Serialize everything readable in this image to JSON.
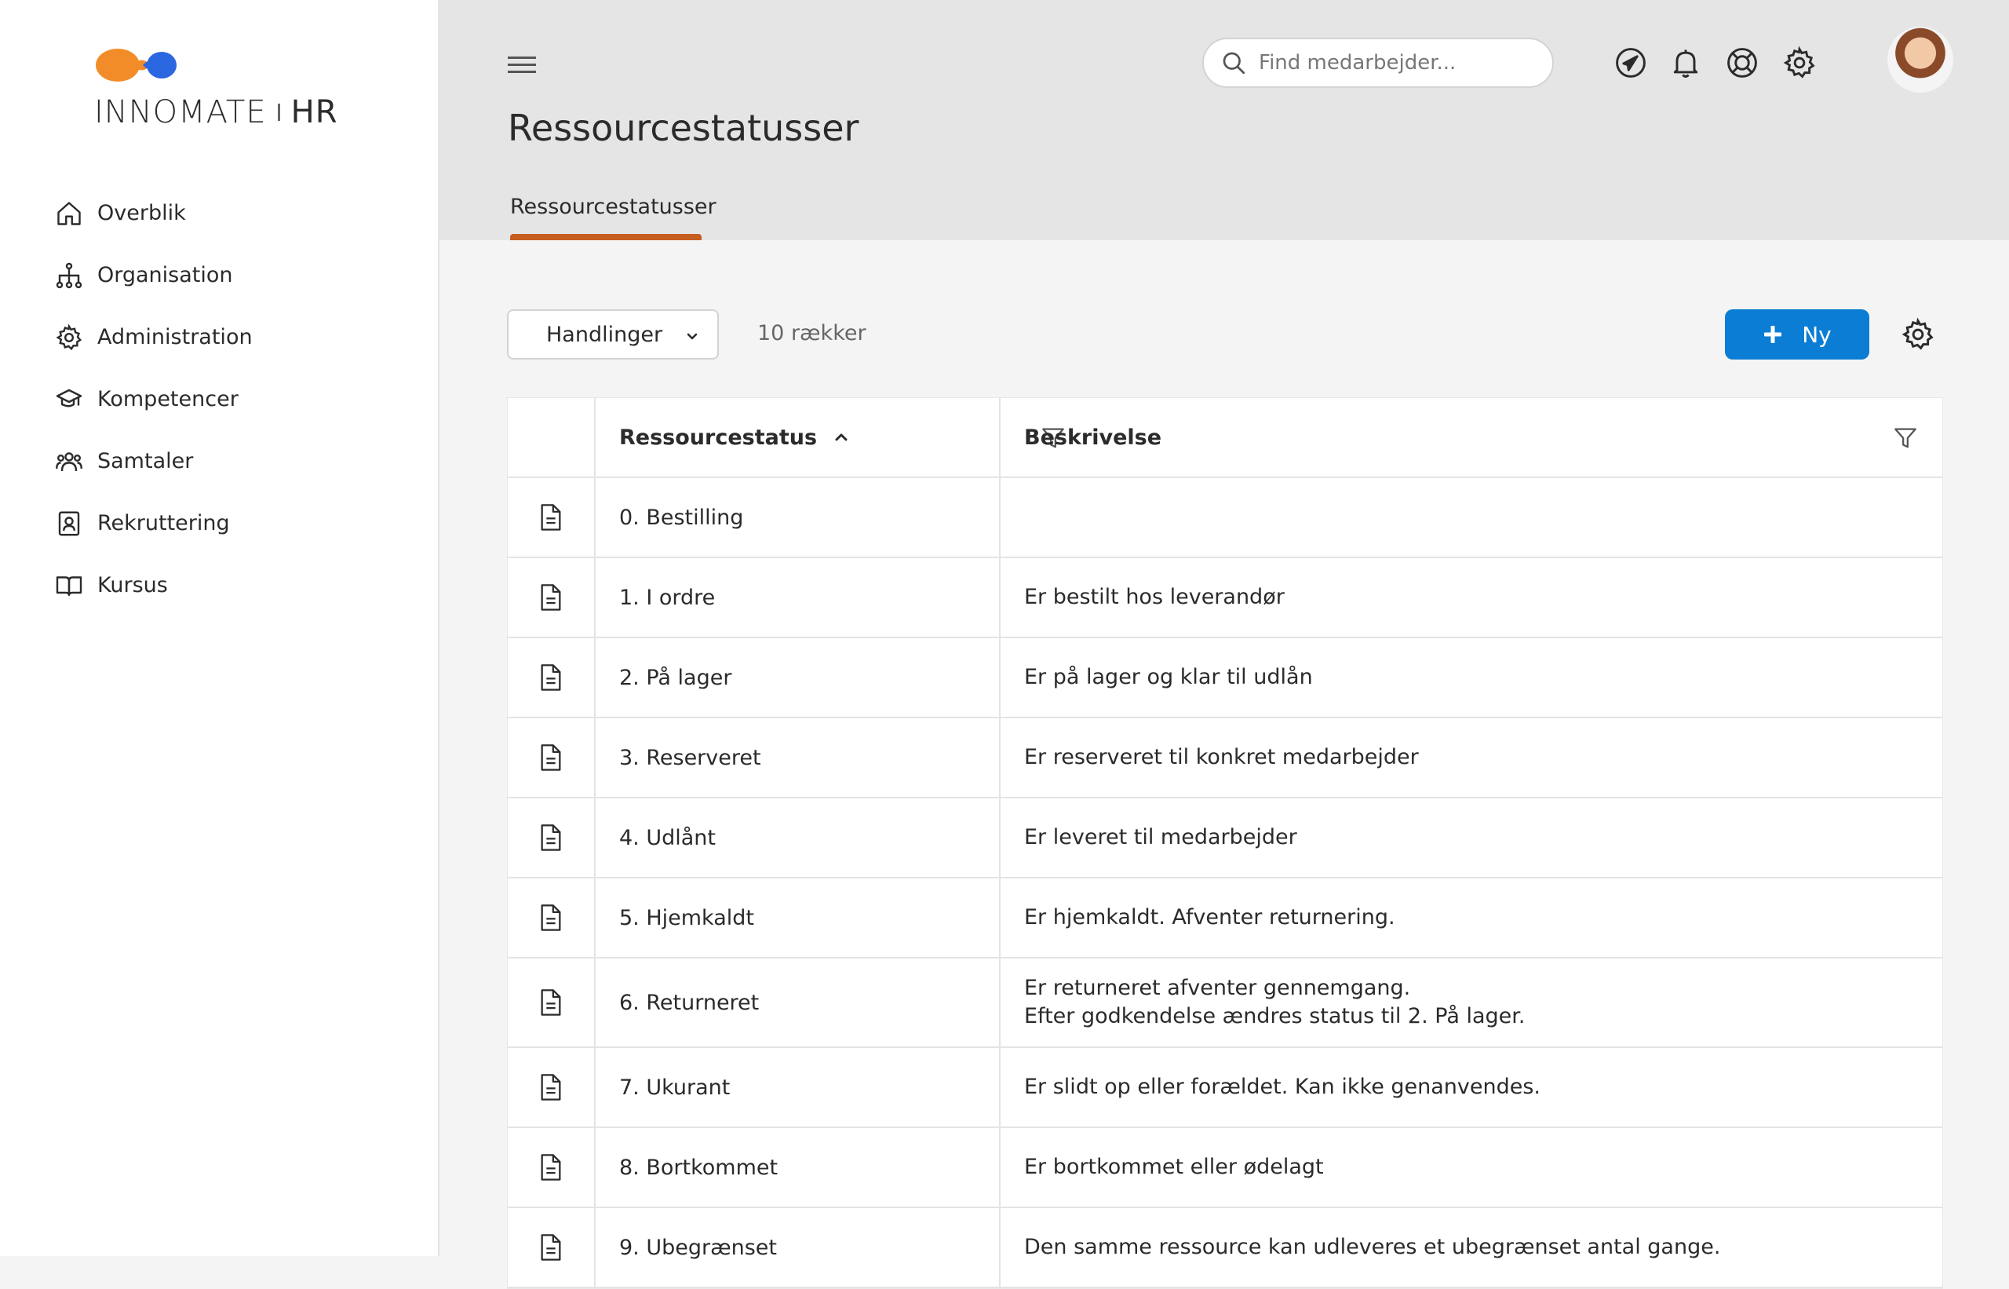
{
  "logo": {
    "part1": "INNOMATE",
    "part2": "HR"
  },
  "sidebar": {
    "items": [
      {
        "label": "Overblik",
        "icon": "home-icon"
      },
      {
        "label": "Organisation",
        "icon": "org-chart-icon"
      },
      {
        "label": "Administration",
        "icon": "gear-icon"
      },
      {
        "label": "Kompetencer",
        "icon": "graduation-cap-icon"
      },
      {
        "label": "Samtaler",
        "icon": "people-icon"
      },
      {
        "label": "Rekruttering",
        "icon": "id-badge-icon"
      },
      {
        "label": "Kursus",
        "icon": "book-icon"
      }
    ]
  },
  "header": {
    "title": "Ressourcestatusser",
    "tab": "Ressourcestatusser",
    "search_placeholder": "Find medarbejder...",
    "accent": "#c65d21"
  },
  "toolbar": {
    "actions_label": "Handlinger",
    "row_count": "10 rækker",
    "new_label": "Ny",
    "new_color": "#0b7dd4"
  },
  "table": {
    "columns": [
      "Ressourcestatus",
      "Beskrivelse"
    ],
    "rows": [
      {
        "status": "0. Bestilling",
        "desc": [
          ""
        ]
      },
      {
        "status": "1. I ordre",
        "desc": [
          "Er bestilt hos leverandør"
        ]
      },
      {
        "status": "2. På lager",
        "desc": [
          "Er på lager og klar til udlån"
        ]
      },
      {
        "status": "3. Reserveret",
        "desc": [
          "Er reserveret til konkret medarbejder"
        ]
      },
      {
        "status": "4. Udlånt",
        "desc": [
          "Er leveret til medarbejder"
        ]
      },
      {
        "status": "5. Hjemkaldt",
        "desc": [
          "Er hjemkaldt. Afventer returnering."
        ]
      },
      {
        "status": "6. Returneret",
        "desc": [
          "Er returneret afventer gennemgang.",
          "Efter godkendelse ændres status til 2. På lager."
        ]
      },
      {
        "status": "7. Ukurant",
        "desc": [
          "Er slidt op eller forældet. Kan ikke genanvendes."
        ]
      },
      {
        "status": "8. Bortkommet",
        "desc": [
          "Er bortkommet eller ødelagt"
        ]
      },
      {
        "status": "9. Ubegrænset",
        "desc": [
          "Den samme ressource kan udleveres et ubegrænset antal gange."
        ]
      }
    ]
  }
}
